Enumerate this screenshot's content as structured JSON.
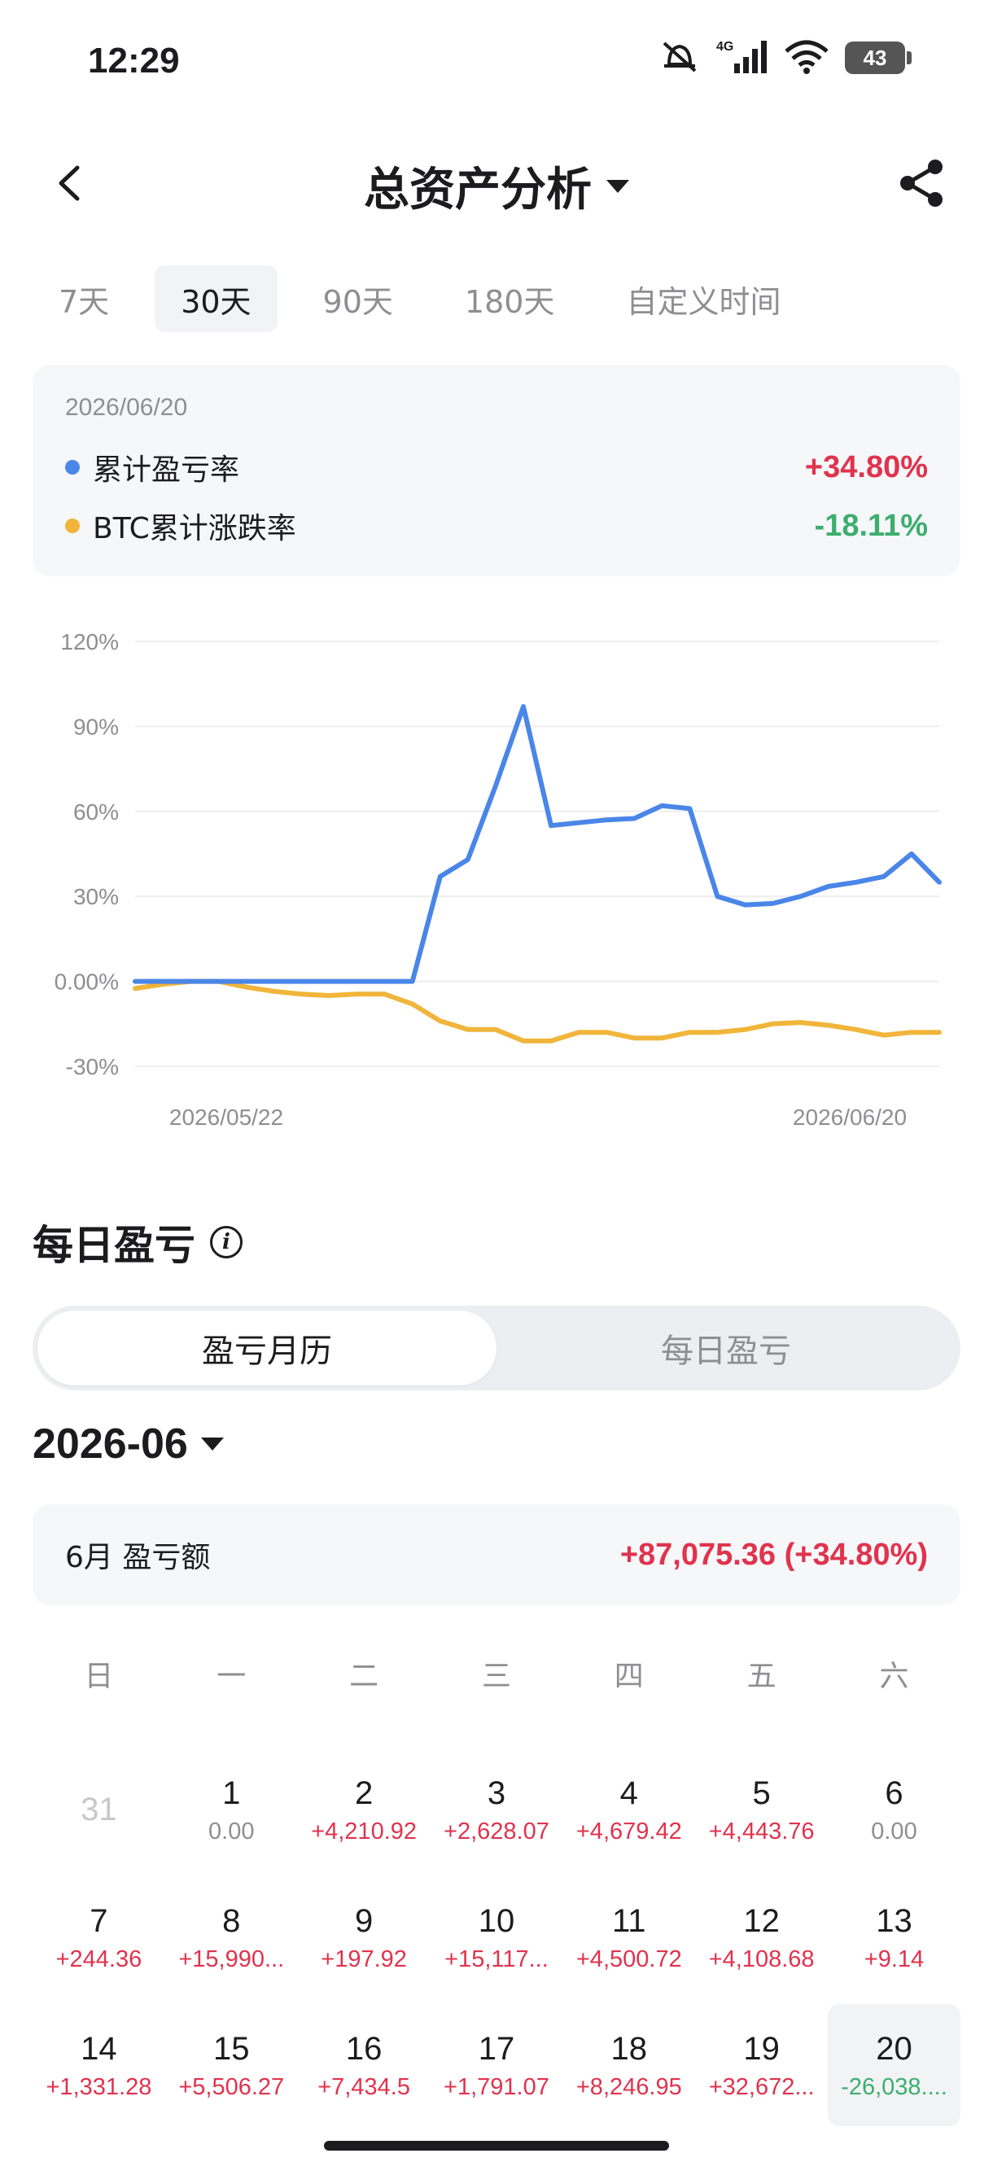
{
  "status": {
    "time": "12:29",
    "network": "4G",
    "battery": "43"
  },
  "header": {
    "title": "总资产分析"
  },
  "range_tabs": [
    {
      "label": "7天",
      "active": false
    },
    {
      "label": "30天",
      "active": true
    },
    {
      "label": "90天",
      "active": false
    },
    {
      "label": "180天",
      "active": false
    },
    {
      "label": "自定义时间",
      "active": false
    }
  ],
  "legend": {
    "date": "2026/06/20",
    "series1": {
      "label": "累计盈亏率",
      "value": "+34.80%",
      "color": "#4a86e8"
    },
    "series2": {
      "label": "BTC累计涨跌率",
      "value": "-18.11%",
      "color": "#f0b53a"
    }
  },
  "chart_data": {
    "type": "line",
    "x_labels": [
      "2026/05/22",
      "2026/06/20"
    ],
    "y_ticks": [
      "120%",
      "90%",
      "60%",
      "30%",
      "0.00%",
      "-30%"
    ],
    "y_tick_values": [
      120,
      90,
      60,
      30,
      0,
      -30
    ],
    "ylim": [
      -30,
      120
    ],
    "grid": true,
    "series": [
      {
        "name": "累计盈亏率",
        "color": "#4a86e8",
        "values": [
          0,
          0,
          0,
          0,
          0,
          0,
          0,
          0,
          0,
          0,
          0,
          37,
          43,
          69,
          97,
          55,
          56,
          57,
          57.5,
          62,
          61,
          30,
          27,
          27.5,
          30,
          33.5,
          35,
          37,
          45,
          35
        ]
      },
      {
        "name": "BTC累计涨跌率",
        "color": "#f0b53a",
        "values": [
          -2.5,
          -1,
          0,
          0,
          -2,
          -3.5,
          -4.5,
          -5,
          -4.5,
          -4.5,
          -8,
          -14,
          -17,
          -17,
          -21,
          -21,
          -18,
          -18,
          -20,
          -20,
          -18,
          -18,
          -17,
          -15,
          -14.5,
          -15.5,
          -17,
          -19,
          -18,
          -18
        ]
      }
    ]
  },
  "daily": {
    "title": "每日盈亏",
    "seg": {
      "calendar": "盈亏月历",
      "daily": "每日盈亏"
    },
    "month": "2026-06",
    "month_card": {
      "label": "6月 盈亏额",
      "value": "+87,075.36 (+34.80%)"
    },
    "weekdays": [
      "日",
      "一",
      "二",
      "三",
      "四",
      "五",
      "六"
    ],
    "rows": [
      [
        {
          "day": "31",
          "value": "",
          "tone": "muted"
        },
        {
          "day": "1",
          "value": "0.00",
          "tone": "zero"
        },
        {
          "day": "2",
          "value": "+4,210.92",
          "tone": "pos"
        },
        {
          "day": "3",
          "value": "+2,628.07",
          "tone": "pos"
        },
        {
          "day": "4",
          "value": "+4,679.42",
          "tone": "pos"
        },
        {
          "day": "5",
          "value": "+4,443.76",
          "tone": "pos"
        },
        {
          "day": "6",
          "value": "0.00",
          "tone": "zero"
        }
      ],
      [
        {
          "day": "7",
          "value": "+244.36",
          "tone": "pos"
        },
        {
          "day": "8",
          "value": "+15,990...",
          "tone": "pos"
        },
        {
          "day": "9",
          "value": "+197.92",
          "tone": "pos"
        },
        {
          "day": "10",
          "value": "+15,117...",
          "tone": "pos"
        },
        {
          "day": "11",
          "value": "+4,500.72",
          "tone": "pos"
        },
        {
          "day": "12",
          "value": "+4,108.68",
          "tone": "pos"
        },
        {
          "day": "13",
          "value": "+9.14",
          "tone": "pos"
        }
      ],
      [
        {
          "day": "14",
          "value": "+1,331.28",
          "tone": "pos"
        },
        {
          "day": "15",
          "value": "+5,506.27",
          "tone": "pos"
        },
        {
          "day": "16",
          "value": "+7,434.5",
          "tone": "pos"
        },
        {
          "day": "17",
          "value": "+1,791.07",
          "tone": "pos"
        },
        {
          "day": "18",
          "value": "+8,246.95",
          "tone": "pos"
        },
        {
          "day": "19",
          "value": "+32,672...",
          "tone": "pos"
        },
        {
          "day": "20",
          "value": "-26,038....",
          "tone": "neg",
          "today": true
        }
      ]
    ]
  }
}
